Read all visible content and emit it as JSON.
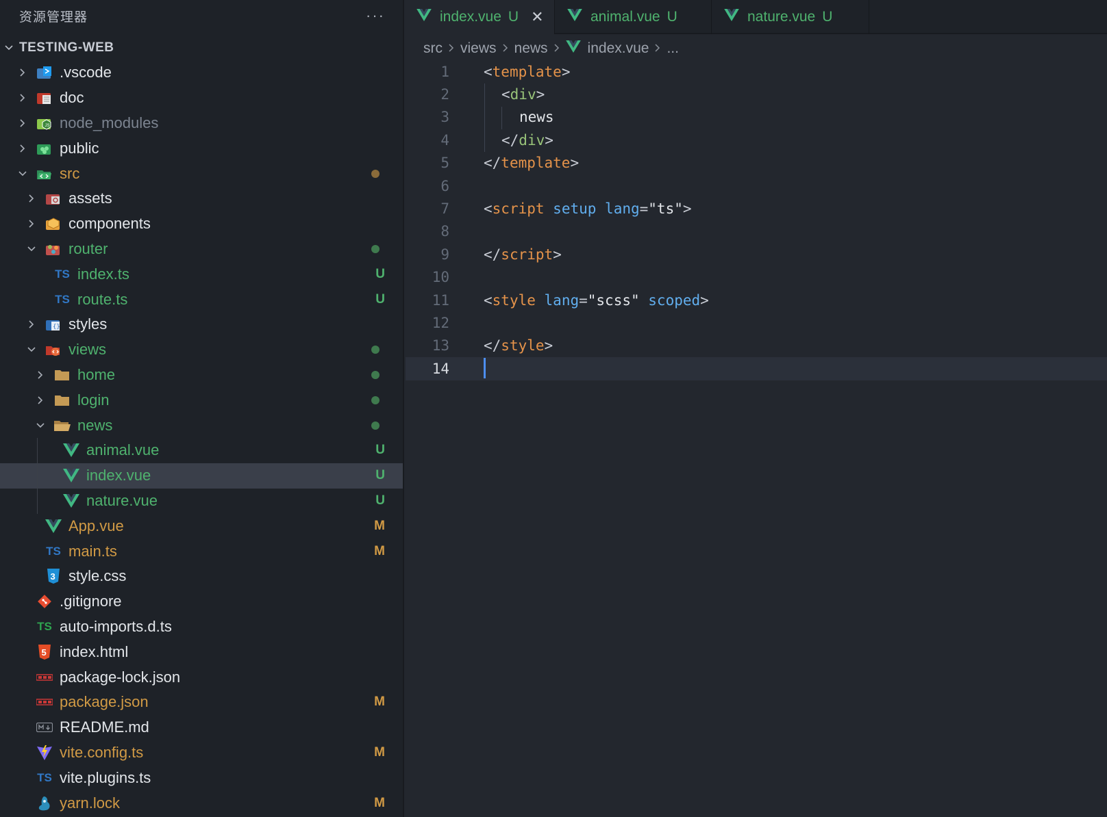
{
  "sidebar": {
    "title": "资源管理器",
    "more_label": "···",
    "project": "TESTING-WEB",
    "items": [
      {
        "label": ".vscode",
        "icon": "vscode-folder-icon",
        "color": "#e3e6ea",
        "status": ""
      },
      {
        "label": "doc",
        "icon": "doc-folder-icon",
        "color": "#e3e6ea",
        "status": ""
      },
      {
        "label": "node_modules",
        "icon": "node-folder-icon",
        "color": "#7c8490",
        "status": ""
      },
      {
        "label": "public",
        "icon": "public-folder-icon",
        "color": "#e3e6ea",
        "status": ""
      },
      {
        "label": "src",
        "icon": "src-folder-icon",
        "color": "#d19a45",
        "status": "dot"
      },
      {
        "label": "assets",
        "icon": "assets-folder-icon",
        "color": "#e3e6ea",
        "status": ""
      },
      {
        "label": "components",
        "icon": "components-folder-icon",
        "color": "#e3e6ea",
        "status": ""
      },
      {
        "label": "router",
        "icon": "router-folder-icon",
        "color": "#4fb26e",
        "status": "dot"
      },
      {
        "label": "index.ts",
        "icon": "typescript-file-icon",
        "color": "#4fb26e",
        "status": "U"
      },
      {
        "label": "route.ts",
        "icon": "typescript-file-icon",
        "color": "#4fb26e",
        "status": "U"
      },
      {
        "label": "styles",
        "icon": "styles-folder-icon",
        "color": "#e3e6ea",
        "status": ""
      },
      {
        "label": "views",
        "icon": "views-folder-icon",
        "color": "#4fb26e",
        "status": "dot"
      },
      {
        "label": "home",
        "icon": "folder-icon",
        "color": "#4fb26e",
        "status": "dot"
      },
      {
        "label": "login",
        "icon": "folder-icon",
        "color": "#4fb26e",
        "status": "dot"
      },
      {
        "label": "news",
        "icon": "folder-open-icon",
        "color": "#4fb26e",
        "status": "dot"
      },
      {
        "label": "animal.vue",
        "icon": "vue-file-icon",
        "color": "#4fb26e",
        "status": "U"
      },
      {
        "label": "index.vue",
        "icon": "vue-file-icon",
        "color": "#4fb26e",
        "status": "U"
      },
      {
        "label": "nature.vue",
        "icon": "vue-file-icon",
        "color": "#4fb26e",
        "status": "U"
      },
      {
        "label": "App.vue",
        "icon": "vue-file-icon",
        "color": "#d19a45",
        "status": "M"
      },
      {
        "label": "main.ts",
        "icon": "typescript-file-icon",
        "color": "#d19a45",
        "status": "M"
      },
      {
        "label": "style.css",
        "icon": "css-file-icon",
        "color": "#e3e6ea",
        "status": ""
      },
      {
        "label": ".gitignore",
        "icon": "git-file-icon",
        "color": "#e3e6ea",
        "status": ""
      },
      {
        "label": "auto-imports.d.ts",
        "icon": "typescript-def-icon",
        "color": "#e3e6ea",
        "status": ""
      },
      {
        "label": "index.html",
        "icon": "html-file-icon",
        "color": "#e3e6ea",
        "status": ""
      },
      {
        "label": "package-lock.json",
        "icon": "npm-file-icon",
        "color": "#e3e6ea",
        "status": ""
      },
      {
        "label": "package.json",
        "icon": "npm-file-icon",
        "color": "#d19a45",
        "status": "M"
      },
      {
        "label": "README.md",
        "icon": "markdown-file-icon",
        "color": "#e3e6ea",
        "status": ""
      },
      {
        "label": "vite.config.ts",
        "icon": "vite-file-icon",
        "color": "#d19a45",
        "status": "M"
      },
      {
        "label": "vite.plugins.ts",
        "icon": "typescript-file-icon",
        "color": "#e3e6ea",
        "status": ""
      },
      {
        "label": "yarn.lock",
        "icon": "yarn-file-icon",
        "color": "#d19a45",
        "status": "M"
      }
    ]
  },
  "tabs": [
    {
      "label": "index.vue",
      "status": "U",
      "close": "✕",
      "active": true
    },
    {
      "label": "animal.vue",
      "status": "U",
      "active": false
    },
    {
      "label": "nature.vue",
      "status": "U",
      "active": false
    }
  ],
  "breadcrumb": {
    "parts": [
      "src",
      "views",
      "news",
      "index.vue",
      "..."
    ]
  },
  "editor": {
    "current_line": "14",
    "line_numbers": [
      "1",
      "2",
      "3",
      "4",
      "5",
      "6",
      "7",
      "8",
      "9",
      "10",
      "11",
      "12",
      "13",
      "14"
    ],
    "tokens": {
      "l1": [
        "<",
        "template",
        ">"
      ],
      "l2": [
        "<",
        "div",
        ">"
      ],
      "l3": [
        "news"
      ],
      "l4": [
        "</",
        "div",
        ">"
      ],
      "l5": [
        "</",
        "template",
        ">"
      ],
      "l7": [
        "<",
        "script",
        " ",
        "setup",
        " ",
        "lang",
        "=",
        "\"ts\"",
        ">"
      ],
      "l9": [
        "</",
        "script",
        ">"
      ],
      "l11": [
        "<",
        "style",
        " ",
        "lang",
        "=",
        "\"scss\"",
        " ",
        "scoped",
        ">"
      ],
      "l13": [
        "</",
        "style",
        ">"
      ]
    }
  },
  "colors": {
    "green": "#4fb26e",
    "orange": "#d19a45",
    "cursor": "#4d8ef0",
    "sidebar_bg": "#1e2228",
    "editor_bg": "#23272e"
  }
}
